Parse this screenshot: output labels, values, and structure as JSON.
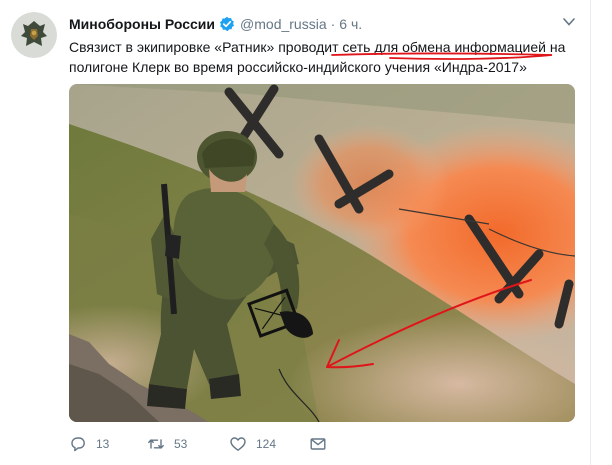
{
  "tweet": {
    "display_name": "Минобороны России",
    "handle": "@mod_russia",
    "separator": "·",
    "time": "6 ч.",
    "text_before": "Связист в экипировке «Ратник» проводит ",
    "text_highlight": "сеть для обмена информацией",
    "text_after": " на полигоне Клерк во время российско-индийского учения «Индра-2017»",
    "icons": {
      "avatar": "army-emblem-avatar",
      "verified": "verified-badge-icon",
      "caret": "chevron-down-icon"
    },
    "colors": {
      "verified": "#1da1f2",
      "annotation": "#e0151a",
      "muted": "#657786"
    }
  },
  "actions": {
    "reply_count": "13",
    "retweet_count": "53",
    "like_count": "124",
    "icons": [
      "reply-icon",
      "retweet-icon",
      "like-icon",
      "message-icon"
    ]
  }
}
